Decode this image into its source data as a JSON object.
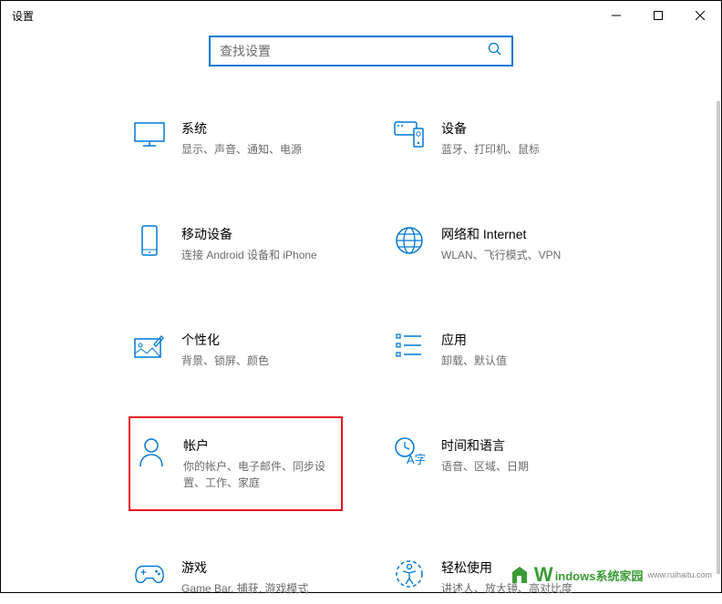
{
  "window": {
    "title": "设置"
  },
  "search": {
    "placeholder": "查找设置"
  },
  "categories": [
    {
      "id": "system",
      "title": "系统",
      "desc": "显示、声音、通知、电源"
    },
    {
      "id": "devices",
      "title": "设备",
      "desc": "蓝牙、打印机、鼠标"
    },
    {
      "id": "phone",
      "title": "移动设备",
      "desc": "连接 Android 设备和 iPhone"
    },
    {
      "id": "network",
      "title": "网络和 Internet",
      "desc": "WLAN、飞行模式、VPN"
    },
    {
      "id": "personalization",
      "title": "个性化",
      "desc": "背景、锁屏、颜色"
    },
    {
      "id": "apps",
      "title": "应用",
      "desc": "卸载、默认值"
    },
    {
      "id": "accounts",
      "title": "帐户",
      "desc": "你的帐户、电子邮件、同步设置、工作、家庭"
    },
    {
      "id": "time",
      "title": "时间和语言",
      "desc": "语音、区域、日期"
    },
    {
      "id": "gaming",
      "title": "游戏",
      "desc": "Game Bar, 捕获, 游戏模式"
    },
    {
      "id": "ease",
      "title": "轻松使用",
      "desc": "讲述人、放大镜、高对比度"
    }
  ],
  "watermark": {
    "text1": "indows系统家园",
    "text2": "www.ruihaitu.com"
  }
}
